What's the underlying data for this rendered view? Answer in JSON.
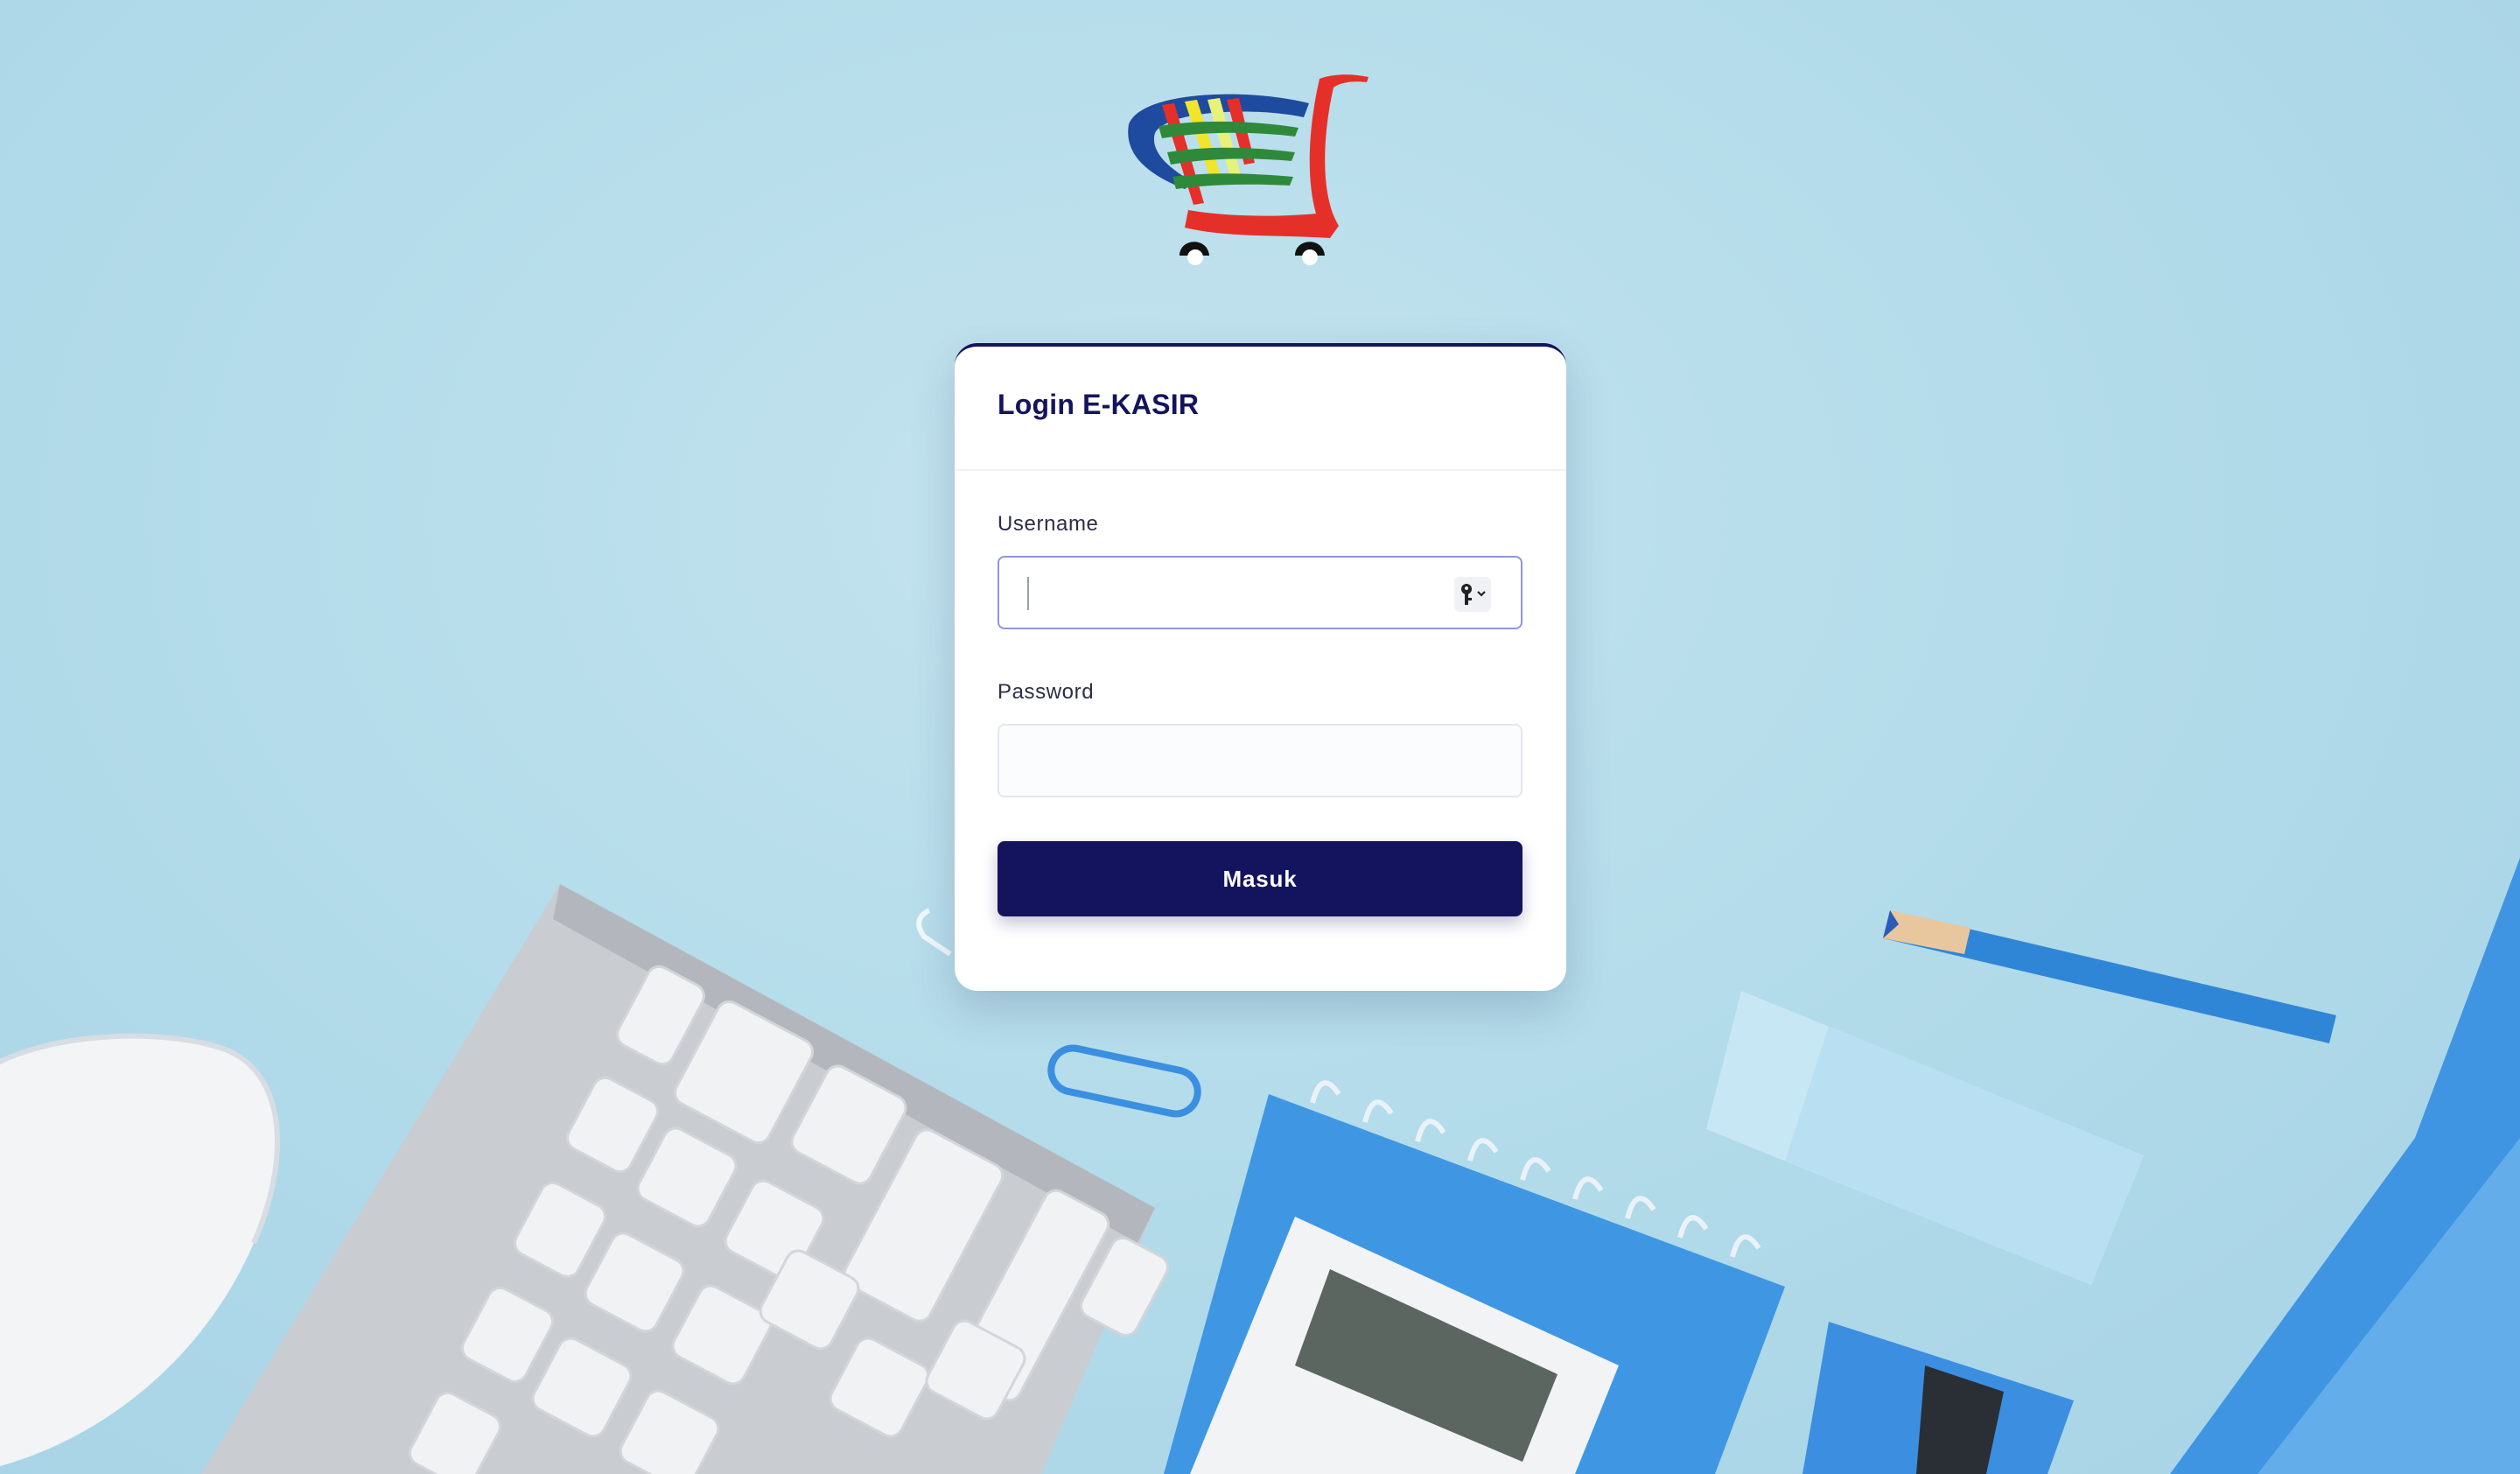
{
  "login": {
    "title": "Login E-KASIR",
    "username_label": "Username",
    "username_value": "",
    "password_label": "Password",
    "password_value": "",
    "submit_label": "Masuk"
  },
  "icons": {
    "logo": "shopping-cart-logo",
    "password_manager": "key-icon"
  },
  "colors": {
    "primary": "#14145e",
    "background": "#b4dcea",
    "focus_border": "#8f95dc"
  }
}
